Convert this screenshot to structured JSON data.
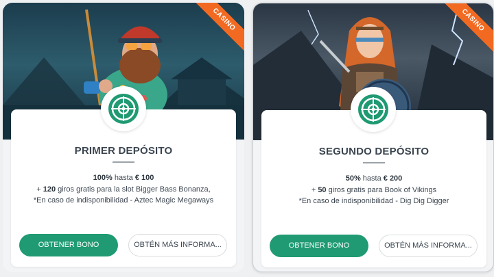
{
  "colors": {
    "accent": "#1f9a72",
    "ribbon": "#f26a21"
  },
  "cards": [
    {
      "ribbon": "CASINO",
      "title": "PRIMER DEPÓSITO",
      "pct": "100%",
      "hasta": " hasta ",
      "amount": "€ 100",
      "plus": "+ ",
      "spins": "120",
      "spins_text": " giros gratis para la slot  Bigger Bass Bonanza,",
      "note": "*En caso de indisponibilidad - Aztec Magic Megaways",
      "primary_btn": "OBTENER BONO",
      "secondary_btn": "OBTÉN MÁS INFORMA...",
      "badge_icon": "roulette-icon"
    },
    {
      "ribbon": "CASINO",
      "title": "SEGUNDO DEPÓSITO",
      "pct": "50%",
      "hasta": " hasta ",
      "amount": "€ 200",
      "plus": "+ ",
      "spins": "50",
      "spins_text": " giros gratis para Book of Vikings",
      "note": "*En caso de indisponibilidad - Dig Dig Digger",
      "primary_btn": "OBTENER BONO",
      "secondary_btn": "OBTÉN MÁS INFORMA...",
      "badge_icon": "roulette-icon"
    }
  ]
}
